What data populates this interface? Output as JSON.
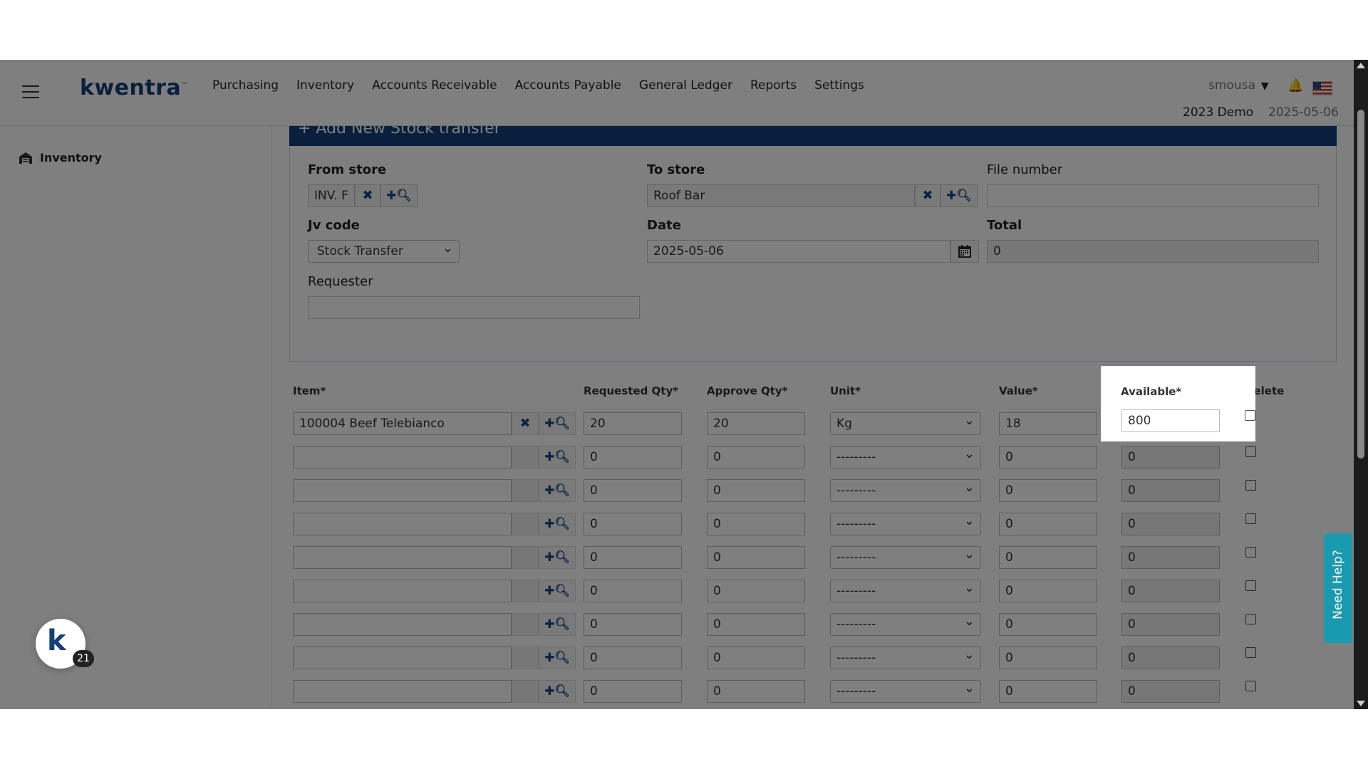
{
  "header": {
    "logo": "kwentra",
    "nav": [
      "Purchasing",
      "Inventory",
      "Accounts Receivable",
      "Accounts Payable",
      "General Ledger",
      "Reports",
      "Settings"
    ],
    "user": "smousa",
    "company": "2023 Demo",
    "date": "2025-05-06"
  },
  "sidebar": {
    "item": "Inventory",
    "badge_count": "21"
  },
  "form": {
    "title": "+ Add New Stock transfer",
    "from_store_label": "From store",
    "from_store_value": "INV. F",
    "to_store_label": "To store",
    "to_store_value": "Roof Bar",
    "file_number_label": "File number",
    "file_number_value": "",
    "jv_code_label": "Jv code",
    "jv_code_value": "Stock Transfer",
    "date_label": "Date",
    "date_value": "2025-05-06",
    "total_label": "Total",
    "total_value": "0",
    "requester_label": "Requester",
    "requester_value": ""
  },
  "table": {
    "headers": {
      "item": "Item*",
      "requested": "Requested Qty*",
      "approve": "Approve Qty*",
      "unit": "Unit*",
      "value": "Value*",
      "available": "Available*",
      "delete": "Delete"
    },
    "rows": [
      {
        "item": "100004 Beef Telebianco",
        "requested": "20",
        "approve": "20",
        "unit": "Kg",
        "value": "18",
        "available": "800"
      },
      {
        "item": "",
        "requested": "0",
        "approve": "0",
        "unit": "---------",
        "value": "0",
        "available": "0"
      },
      {
        "item": "",
        "requested": "0",
        "approve": "0",
        "unit": "---------",
        "value": "0",
        "available": "0"
      },
      {
        "item": "",
        "requested": "0",
        "approve": "0",
        "unit": "---------",
        "value": "0",
        "available": "0"
      },
      {
        "item": "",
        "requested": "0",
        "approve": "0",
        "unit": "---------",
        "value": "0",
        "available": "0"
      },
      {
        "item": "",
        "requested": "0",
        "approve": "0",
        "unit": "---------",
        "value": "0",
        "available": "0"
      },
      {
        "item": "",
        "requested": "0",
        "approve": "0",
        "unit": "---------",
        "value": "0",
        "available": "0"
      },
      {
        "item": "",
        "requested": "0",
        "approve": "0",
        "unit": "---------",
        "value": "0",
        "available": "0"
      },
      {
        "item": "",
        "requested": "0",
        "approve": "0",
        "unit": "---------",
        "value": "0",
        "available": "0"
      }
    ]
  },
  "help_tab": "Need Help?",
  "colors": {
    "brand": "#163f7a",
    "panel_header": "#123f7b",
    "help": "#1a9ab0"
  }
}
